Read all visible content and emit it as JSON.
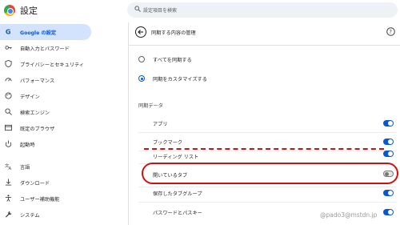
{
  "app": {
    "title": "設定"
  },
  "search": {
    "placeholder": "設定項目を検索"
  },
  "sidebar": {
    "items": [
      {
        "label": "Google の設定",
        "icon": "google-icon",
        "active": true
      },
      {
        "label": "自動入力とパスワード",
        "icon": "key-icon"
      },
      {
        "label": "プライバシーとセキュリティ",
        "icon": "shield-icon"
      },
      {
        "label": "パフォーマンス",
        "icon": "speedometer-icon"
      },
      {
        "label": "デザイン",
        "icon": "palette-icon"
      },
      {
        "label": "検索エンジン",
        "icon": "search-icon"
      },
      {
        "label": "既定のブラウザ",
        "icon": "browser-icon"
      },
      {
        "label": "起動時",
        "icon": "power-icon"
      },
      {
        "label": "言語",
        "icon": "translate-icon"
      },
      {
        "label": "ダウンロード",
        "icon": "download-icon"
      },
      {
        "label": "ユーザー補助機能",
        "icon": "accessibility-icon"
      },
      {
        "label": "システム",
        "icon": "wrench-icon"
      }
    ]
  },
  "main": {
    "title": "同期する内容の管理",
    "radios": [
      {
        "label": "すべてを同期する",
        "selected": false
      },
      {
        "label": "同期をカスタマイズする",
        "selected": true
      }
    ],
    "section_title": "同期データ",
    "rows": [
      {
        "label": "アプリ",
        "on": true
      },
      {
        "label": "ブックマーク",
        "on": true
      },
      {
        "label": "リーディング リスト",
        "on": true
      },
      {
        "label": "開いているタブ",
        "on": false
      },
      {
        "label": "保存したタブグループ",
        "on": true
      },
      {
        "label": "パスワードとパスキー",
        "on": true
      }
    ]
  },
  "colors": {
    "accent": "#0b57d0",
    "annotation": "#d01010"
  },
  "watermark": "@pado3@mstdn.jp"
}
